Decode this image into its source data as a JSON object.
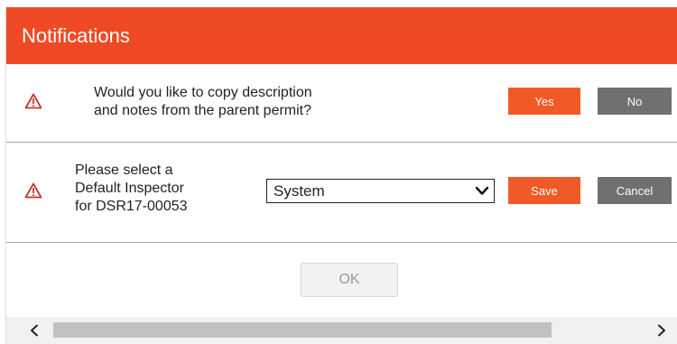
{
  "title": "Notifications",
  "colors": {
    "accent": "#ef4a25",
    "button_primary": "#ef5a26",
    "button_secondary": "#707070",
    "warning_icon": "#c0392b"
  },
  "copy_prompt": {
    "icon": "warning-triangle-icon",
    "message_line1": "Would you like to copy description",
    "message_line2": "and notes from the parent permit?",
    "yes_label": "Yes",
    "no_label": "No"
  },
  "inspector_prompt": {
    "icon": "warning-triangle-icon",
    "message_line1": "Please select a",
    "message_line2": "Default Inspector",
    "message_line3": "for DSR17-00053",
    "selected_value": "System",
    "save_label": "Save",
    "cancel_label": "Cancel"
  },
  "footer": {
    "ok_label": "OK"
  },
  "scrollbar": {
    "left_icon": "chevron-left-icon",
    "right_icon": "chevron-right-icon"
  }
}
